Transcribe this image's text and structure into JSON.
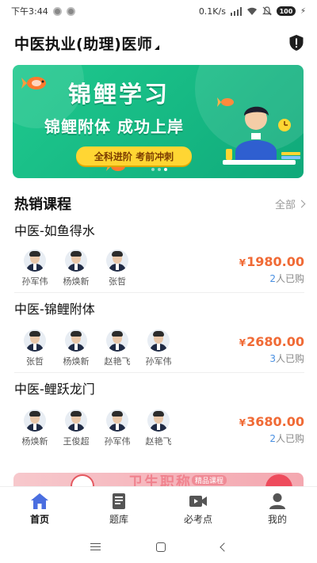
{
  "status_bar": {
    "time": "下午3:44",
    "network_speed": "0.1K/s",
    "battery": "100"
  },
  "header": {
    "title": "中医执业(助理)医师",
    "icon": "shield-alert-icon"
  },
  "banner": {
    "title": "锦鲤学习",
    "subtitle": "锦鲤附体 成功上岸",
    "pill": "全科进阶 考前冲刺",
    "slides_total": 3,
    "active_slide": 3,
    "brand_color": "#16b883"
  },
  "hot_courses": {
    "title": "热销课程",
    "more_label": "全部",
    "courses": [
      {
        "title": "中医-如鱼得水",
        "teachers": [
          "孙军伟",
          "杨焕新",
          "张哲"
        ],
        "price": "1980.00",
        "currency": "¥",
        "buyers_count": "2",
        "buyers_suffix": "人已购"
      },
      {
        "title": "中医-锦鲤附体",
        "teachers": [
          "张哲",
          "杨焕新",
          "赵艳飞",
          "孙军伟"
        ],
        "price": "2680.00",
        "currency": "¥",
        "buyers_count": "3",
        "buyers_suffix": "人已购"
      },
      {
        "title": "中医-鲤跃龙门",
        "teachers": [
          "杨焕新",
          "王俊超",
          "孙军伟",
          "赵艳飞"
        ],
        "price": "3680.00",
        "currency": "¥",
        "buyers_count": "2",
        "buyers_suffix": "人已购"
      }
    ]
  },
  "promo": {
    "text": "卫生职称",
    "tag": "精品课程"
  },
  "tabbar": {
    "items": [
      {
        "label": "首页",
        "icon": "home-icon",
        "active": true
      },
      {
        "label": "题库",
        "icon": "question-bank-icon",
        "active": false
      },
      {
        "label": "必考点",
        "icon": "video-icon",
        "active": false
      },
      {
        "label": "我的",
        "icon": "profile-icon",
        "active": false
      }
    ]
  },
  "colors": {
    "accent": "#f06a35",
    "tab_active": "#4a6ee0",
    "buyers_num": "#4a90e2"
  }
}
